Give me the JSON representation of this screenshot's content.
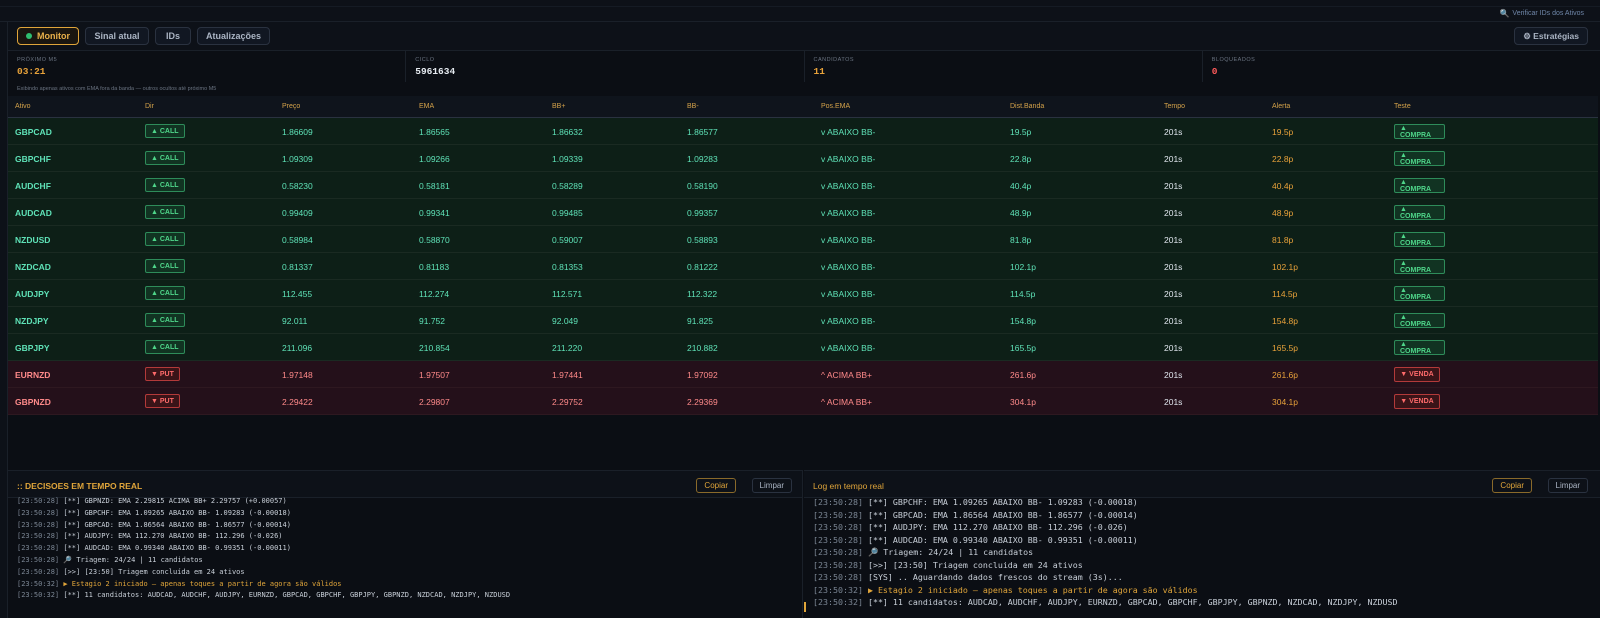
{
  "top": {
    "verify_icon": "search-icon",
    "verify_label": "Verificar IDs dos Ativos"
  },
  "tabs": [
    {
      "label": "Monitor",
      "active": true
    },
    {
      "label": "Sinal atual"
    },
    {
      "label": "IDs"
    },
    {
      "label": "Atualizações"
    }
  ],
  "strategies_label": "⚙ Estratégias",
  "stats": [
    {
      "label": "PRÓXIMO M5",
      "value": "03:21",
      "color": "#e8a23a"
    },
    {
      "label": "CICLO",
      "value": "5961634",
      "color": "#e6ebf1"
    },
    {
      "label": "CANDIDATOS",
      "value": "11",
      "color": "#e8a23a"
    },
    {
      "label": "BLOQUEADOS",
      "value": "0",
      "color": "#ff5a5a"
    }
  ],
  "note": "Exibindo apenas ativos com EMA fora da banda — outros ocultos até próximo M5",
  "table": {
    "headers": [
      "Ativo",
      "Dir",
      "Preço",
      "EMA",
      "BB+",
      "BB-",
      "Pos.EMA",
      "Dist.Banda",
      "Tempo",
      "Alerta",
      "Teste"
    ],
    "rows": [
      {
        "asset": "GBPCAD",
        "dir": "▲ CALL",
        "type": "call",
        "price": "1.86609",
        "ema": "1.86565",
        "bbp": "1.86632",
        "bbm": "1.86577",
        "pos": "v ABAIXO BB-",
        "dist": "19.5p",
        "time": "201s",
        "alert": "19.5p",
        "test": "▲ COMPRA"
      },
      {
        "asset": "GBPCHF",
        "dir": "▲ CALL",
        "type": "call",
        "price": "1.09309",
        "ema": "1.09266",
        "bbp": "1.09339",
        "bbm": "1.09283",
        "pos": "v ABAIXO BB-",
        "dist": "22.8p",
        "time": "201s",
        "alert": "22.8p",
        "test": "▲ COMPRA"
      },
      {
        "asset": "AUDCHF",
        "dir": "▲ CALL",
        "type": "call",
        "price": "0.58230",
        "ema": "0.58181",
        "bbp": "0.58289",
        "bbm": "0.58190",
        "pos": "v ABAIXO BB-",
        "dist": "40.4p",
        "time": "201s",
        "alert": "40.4p",
        "test": "▲ COMPRA"
      },
      {
        "asset": "AUDCAD",
        "dir": "▲ CALL",
        "type": "call",
        "price": "0.99409",
        "ema": "0.99341",
        "bbp": "0.99485",
        "bbm": "0.99357",
        "pos": "v ABAIXO BB-",
        "dist": "48.9p",
        "time": "201s",
        "alert": "48.9p",
        "test": "▲ COMPRA"
      },
      {
        "asset": "NZDUSD",
        "dir": "▲ CALL",
        "type": "call",
        "price": "0.58984",
        "ema": "0.58870",
        "bbp": "0.59007",
        "bbm": "0.58893",
        "pos": "v ABAIXO BB-",
        "dist": "81.8p",
        "time": "201s",
        "alert": "81.8p",
        "test": "▲ COMPRA"
      },
      {
        "asset": "NZDCAD",
        "dir": "▲ CALL",
        "type": "call",
        "price": "0.81337",
        "ema": "0.81183",
        "bbp": "0.81353",
        "bbm": "0.81222",
        "pos": "v ABAIXO BB-",
        "dist": "102.1p",
        "time": "201s",
        "alert": "102.1p",
        "test": "▲ COMPRA"
      },
      {
        "asset": "AUDJPY",
        "dir": "▲ CALL",
        "type": "call",
        "price": "112.455",
        "ema": "112.274",
        "bbp": "112.571",
        "bbm": "112.322",
        "pos": "v ABAIXO BB-",
        "dist": "114.5p",
        "time": "201s",
        "alert": "114.5p",
        "test": "▲ COMPRA"
      },
      {
        "asset": "NZDJPY",
        "dir": "▲ CALL",
        "type": "call",
        "price": "92.011",
        "ema": "91.752",
        "bbp": "92.049",
        "bbm": "91.825",
        "pos": "v ABAIXO BB-",
        "dist": "154.8p",
        "time": "201s",
        "alert": "154.8p",
        "test": "▲ COMPRA"
      },
      {
        "asset": "GBPJPY",
        "dir": "▲ CALL",
        "type": "call",
        "price": "211.096",
        "ema": "210.854",
        "bbp": "211.220",
        "bbm": "210.882",
        "pos": "v ABAIXO BB-",
        "dist": "165.5p",
        "time": "201s",
        "alert": "165.5p",
        "test": "▲ COMPRA"
      },
      {
        "asset": "EURNZD",
        "dir": "▼ PUT",
        "type": "put",
        "price": "1.97148",
        "ema": "1.97507",
        "bbp": "1.97441",
        "bbm": "1.97092",
        "pos": "^ ACIMA BB+",
        "dist": "261.6p",
        "time": "201s",
        "alert": "261.6p",
        "test": "▼ VENDA"
      },
      {
        "asset": "GBPNZD",
        "dir": "▼ PUT",
        "type": "put",
        "price": "2.29422",
        "ema": "2.29807",
        "bbp": "2.29752",
        "bbm": "2.29369",
        "pos": "^ ACIMA BB+",
        "dist": "304.1p",
        "time": "201s",
        "alert": "304.1p",
        "test": "▼ VENDA"
      }
    ]
  },
  "left_panel": {
    "title": ":: DECISOES EM TEMPO REAL",
    "copy": "Copiar",
    "clear": "Limpar",
    "lines": [
      {
        "ts": "[23:50:28]",
        "text": " [**] GBPNZD: EMA 2.29815 ACIMA BB+ 2.29757 (+0.00057)",
        "hl": false
      },
      {
        "ts": "[23:50:28]",
        "text": " [**] GBPCHF: EMA 1.09265 ABAIXO BB- 1.09283 (-0.00018)",
        "hl": false
      },
      {
        "ts": "[23:50:28]",
        "text": " [**] GBPCAD: EMA 1.86564 ABAIXO BB- 1.86577 (-0.00014)",
        "hl": false
      },
      {
        "ts": "[23:50:28]",
        "text": " [**] AUDJPY: EMA 112.270 ABAIXO BB- 112.296 (-0.026)",
        "hl": false
      },
      {
        "ts": "[23:50:28]",
        "text": " [**] AUDCAD: EMA 0.99340 ABAIXO BB- 0.99351 (-0.00011)",
        "hl": false
      },
      {
        "ts": "[23:50:28]",
        "text": " 🔎 Triagem: 24/24 | 11 candidatos",
        "hl": false
      },
      {
        "ts": "[23:50:28]",
        "text": " [>>] [23:50] Triagem concluída em 24 ativos",
        "hl": false
      },
      {
        "ts": "[23:50:32]",
        "text": " ▶ Estagio 2 iniciado — apenas toques a partir de agora são válidos",
        "hl": true
      },
      {
        "ts": "[23:50:32]",
        "text": " [**] 11 candidatos: AUDCAD, AUDCHF, AUDJPY, EURNZD, GBPCAD, GBPCHF, GBPJPY, GBPNZD, NZDCAD, NZDJPY, NZDUSD",
        "hl": false
      }
    ]
  },
  "right_panel": {
    "title": "Log em tempo real",
    "copy": "Copiar",
    "clear": "Limpar",
    "lines": [
      {
        "ts": "[23:50:28]",
        "text": " [**] GBPCHF: EMA 1.09265 ABAIXO BB- 1.09283 (-0.00018)",
        "hl": false
      },
      {
        "ts": "[23:50:28]",
        "text": " [**] GBPCAD: EMA 1.86564 ABAIXO BB- 1.86577 (-0.00014)",
        "hl": false
      },
      {
        "ts": "[23:50:28]",
        "text": " [**] AUDJPY: EMA 112.270 ABAIXO BB- 112.296 (-0.026)",
        "hl": false
      },
      {
        "ts": "[23:50:28]",
        "text": " [**] AUDCAD: EMA 0.99340 ABAIXO BB- 0.99351 (-0.00011)",
        "hl": false
      },
      {
        "ts": "[23:50:28]",
        "text": " 🔎 Triagem: 24/24 | 11 candidatos",
        "hl": false
      },
      {
        "ts": "[23:50:28]",
        "text": " [>>] [23:50] Triagem concluida em 24 ativos",
        "hl": false
      },
      {
        "ts": "[23:50:28]",
        "text": " [SYS] .. Aguardando dados frescos do stream (3s)...",
        "hl": false
      },
      {
        "ts": "[23:50:32]",
        "text": " ▶ Estagio 2 iniciado — apenas toques a partir de agora são válidos",
        "hl": true
      },
      {
        "ts": "[23:50:32]",
        "text": " [**] 11 candidatos: AUDCAD, AUDCHF, AUDJPY, EURNZD, GBPCAD, GBPCHF, GBPJPY, GBPNZD, NZDCAD, NZDJPY, NZDUSD",
        "hl": false
      }
    ]
  }
}
